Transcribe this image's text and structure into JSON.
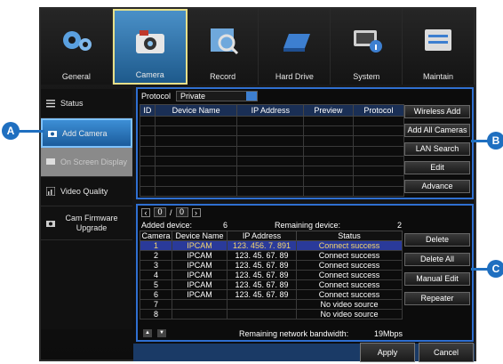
{
  "tabs": [
    {
      "label": "General",
      "icon": "gears-icon"
    },
    {
      "label": "Camera",
      "icon": "camera-icon"
    },
    {
      "label": "Record",
      "icon": "record-icon"
    },
    {
      "label": "Hard Drive",
      "icon": "hard-drive-icon"
    },
    {
      "label": "System",
      "icon": "system-icon"
    },
    {
      "label": "Maintain",
      "icon": "maintain-icon"
    }
  ],
  "sidebar": {
    "items": [
      {
        "label": "Status"
      },
      {
        "label": "Add Camera"
      },
      {
        "label": "On Screen Display"
      },
      {
        "label": "Video Quality"
      },
      {
        "label": "Cam Firmware Upgrade"
      }
    ]
  },
  "search": {
    "protocol_label": "Protocol",
    "protocol_value": "Private",
    "columns": [
      "ID",
      "Device Name",
      "IP Address",
      "Preview",
      "Protocol"
    ],
    "buttons": [
      "Wireless Add",
      "Add All Cameras",
      "LAN Search",
      "Edit",
      "Advance"
    ]
  },
  "added": {
    "pager": {
      "current": "0",
      "sep": "/",
      "total": "0"
    },
    "added_label": "Added device:",
    "added_value": "6",
    "remaining_label": "Remaining device:",
    "remaining_value": "2",
    "columns": [
      "Camera",
      "Device Name",
      "IP Address",
      "Status"
    ],
    "rows": [
      {
        "camera": "1",
        "name": "IPCAM",
        "ip": "123. 456. 7. 891",
        "status": "Connect success"
      },
      {
        "camera": "2",
        "name": "IPCAM",
        "ip": "123. 45. 67. 89",
        "status": "Connect success"
      },
      {
        "camera": "3",
        "name": "IPCAM",
        "ip": "123. 45. 67. 89",
        "status": "Connect success"
      },
      {
        "camera": "4",
        "name": "IPCAM",
        "ip": "123. 45. 67. 89",
        "status": "Connect success"
      },
      {
        "camera": "5",
        "name": "IPCAM",
        "ip": "123. 45. 67. 89",
        "status": "Connect success"
      },
      {
        "camera": "6",
        "name": "IPCAM",
        "ip": "123. 45. 67. 89",
        "status": "Connect success"
      },
      {
        "camera": "7",
        "name": "",
        "ip": "",
        "status": "No video source"
      },
      {
        "camera": "8",
        "name": "",
        "ip": "",
        "status": "No video source"
      }
    ],
    "bandwidth_label": "Remaining network bandwidth:",
    "bandwidth_value": "19Mbps",
    "buttons": [
      "Delete",
      "Delete All",
      "Manual Edit",
      "Repeater"
    ]
  },
  "footer": {
    "apply": "Apply",
    "cancel": "Cancel"
  },
  "callouts": {
    "a": "A",
    "b": "B",
    "c": "C"
  },
  "colors": {
    "accent": "#2f6fd0",
    "callout": "#1f6fc0",
    "active_tab_border": "#e7e08a",
    "selected_text": "#f5d76e"
  }
}
